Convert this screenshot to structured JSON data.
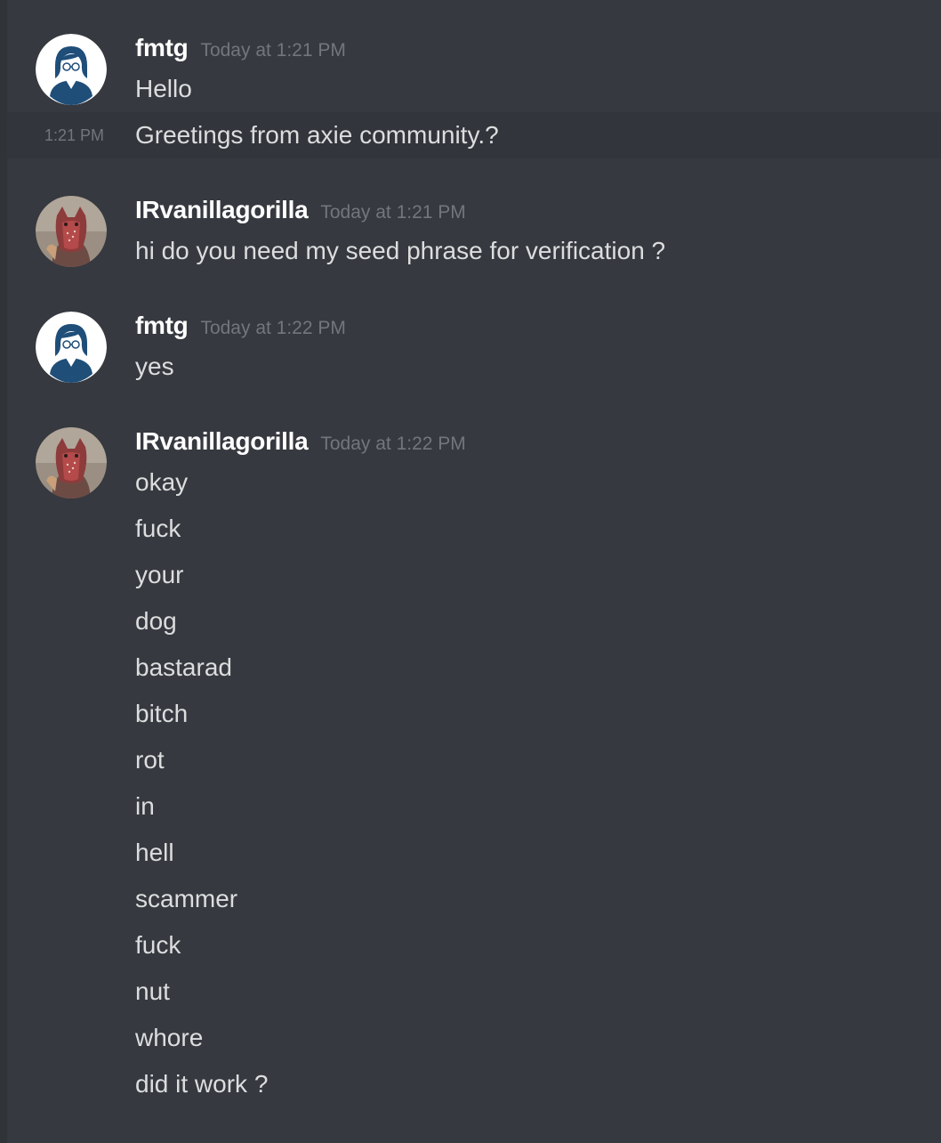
{
  "messages": {
    "group1": {
      "username": "fmtg",
      "timestamp": "Today at 1:21 PM",
      "lines": [
        "Hello",
        "Greetings from axie community.?"
      ],
      "side_time": "1:21 PM"
    },
    "group2": {
      "username": "IRvanillagorilla",
      "timestamp": "Today at 1:21 PM",
      "lines": [
        "hi do you need my seed phrase for verification ?"
      ]
    },
    "group3": {
      "username": "fmtg",
      "timestamp": "Today at 1:22 PM",
      "lines": [
        "yes"
      ]
    },
    "group4": {
      "username": "IRvanillagorilla",
      "timestamp": "Today at 1:22 PM",
      "lines": [
        "okay",
        "fuck",
        "your",
        "dog",
        "bastarad",
        "bitch",
        "rot",
        "in",
        "hell",
        "scammer",
        "fuck",
        "nut",
        "whore",
        "did it work ?"
      ]
    }
  },
  "colors": {
    "background": "#36393f",
    "username": "#ffffff",
    "timestamp": "#72767d",
    "message_text": "#dcddde",
    "hover_row": "#32353b"
  },
  "icons": {
    "fmtg_avatar": "woman-with-glasses-avatar-icon",
    "gorilla_avatar": "masked-person-avatar-icon"
  }
}
